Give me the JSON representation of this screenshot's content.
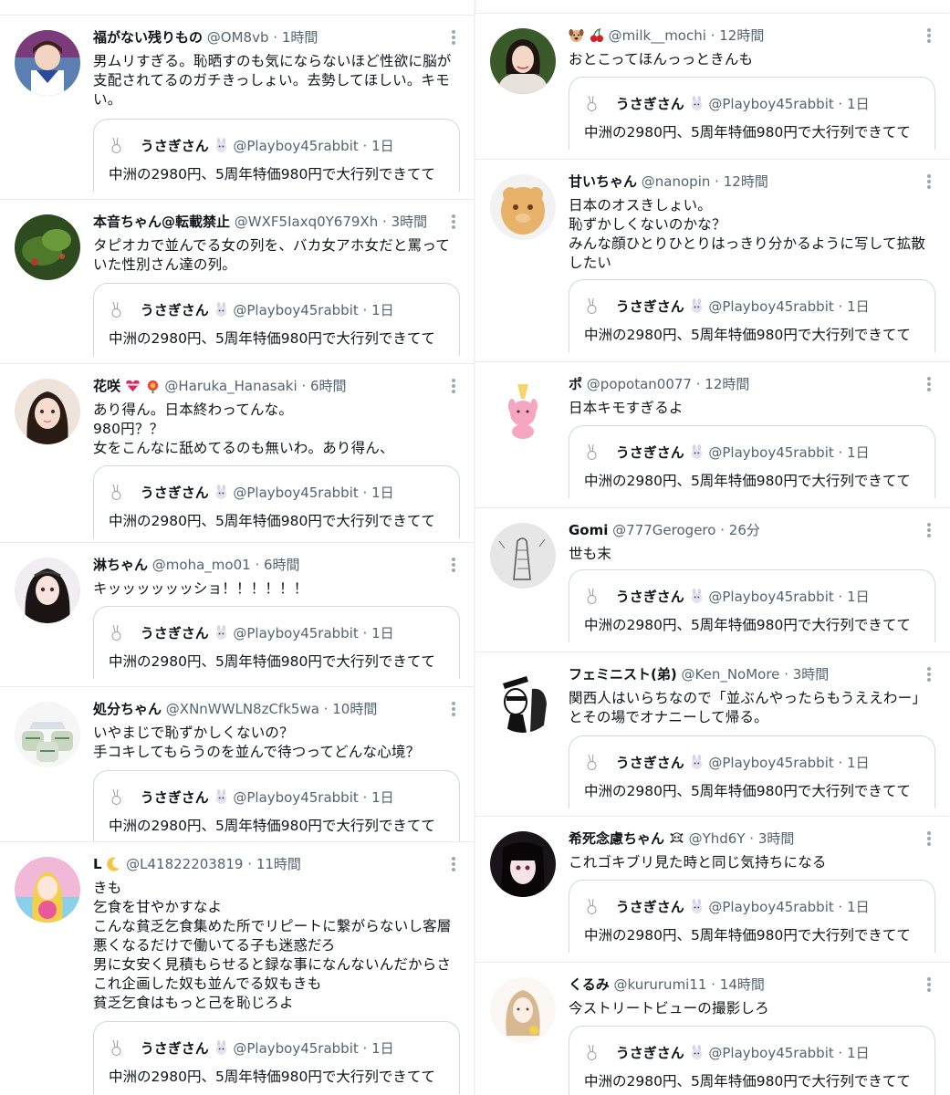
{
  "quoted": {
    "name": "うさぎさん",
    "handle": "@Playboy45rabbit",
    "dot": "·",
    "time": "1日",
    "text": "中洲の2980円、5周年特価980円で大行列できてて"
  },
  "left": [
    {
      "name": "福がない残りもの",
      "handle": "@OM8vb",
      "time": "1時間",
      "text": "男ムリすぎる。恥晒すのも気にならないほど性欲に脳が\n支配されてるのガチきっしょい。去勢してほしい。キモ\nい。"
    },
    {
      "name": "本音ちゃん@転載禁止",
      "handle": "@WXF5Iaxq0Y679Xh",
      "time": "3時間",
      "text": "タピオカで並んでる女の列を、バカ女アホ女だと罵って\nいた性別さん達の列。"
    },
    {
      "name": "花咲",
      "handle": "@Haruka_Hanasaki",
      "time": "6時間",
      "text": "あり得ん。日本終わってんな。\n980円？？\n女をこんなに舐めてるのも無いわ。あり得ん、"
    },
    {
      "name": "淋ちゃん",
      "handle": "@moha_mo01",
      "time": "6時間",
      "text": "キッッッッッッショ！！！！！！"
    },
    {
      "name": "処分ちゃん",
      "handle": "@XNnWWLN8zCfk5wa",
      "time": "10時間",
      "text": "いやまじで恥ずかしくないの？\n手コキしてもらうのを並んで待つってどんな心境？"
    },
    {
      "name": "L",
      "handle": "@L41822203819",
      "time": "11時間",
      "text": "きも\n乞食を甘やかすなよ\nこんな貧乏乞食集めた所でリピートに繋がらないし客層\n悪くなるだけで働いてる子も迷惑だろ\n男に女安く見積もらせると録な事になんないんだからさ\nこれ企画した奴も並んでる奴もきも\n貧乏乞食はもっと己を恥じろよ"
    }
  ],
  "right": [
    {
      "name": "",
      "handle": "@milk__mochi",
      "time": "12時間",
      "text": "おとこってほんっっときんも"
    },
    {
      "name": "甘いちゃん",
      "handle": "@nanopin",
      "time": "12時間",
      "text": "日本のオスきしょい。\n恥ずかしくないのかな？\nみんな顔ひとりひとりはっきり分かるように写して拡散\nしたい"
    },
    {
      "name": "ポ",
      "handle": "@popotan0077",
      "time": "12時間",
      "text": "日本キモすぎるよ"
    },
    {
      "name": "Gomi",
      "handle": "@777Gerogero",
      "time": "26分",
      "text": "世も末"
    },
    {
      "name": "フェミニスト(弟)",
      "handle": "@Ken_NoMore",
      "time": "3時間",
      "text": "関西人はいらちなので「並ぶんやったらもうええわー」\nとその場でオナニーして帰る。"
    },
    {
      "name": "希死念慮ちゃん",
      "handle": "@Yhd6Y",
      "time": "3時間",
      "text": "これゴキブリ見た時と同じ気持ちになる"
    },
    {
      "name": "くるみ",
      "handle": "@kururumi11",
      "time": "14時間",
      "text": "今ストリートビューの撮影しろ"
    }
  ],
  "colors": {
    "name": "#0f1419",
    "secondary": "#536471",
    "border": "#cfd9de",
    "divider": "#e6ecf0"
  },
  "icons": {
    "more": "more-vertical-icon",
    "rabbit": "rabbit-emoji-icon"
  }
}
